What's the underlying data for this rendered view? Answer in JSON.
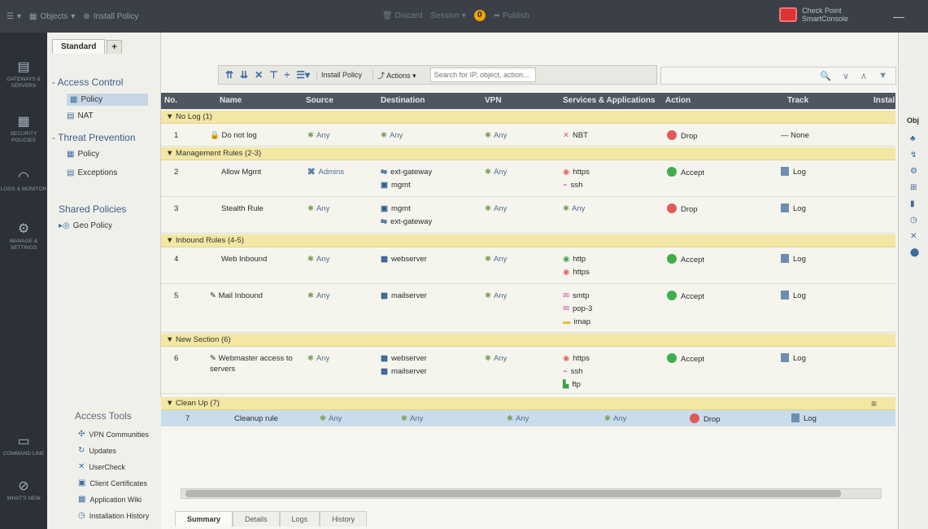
{
  "topbar": {
    "menu_label": "☰",
    "objects_label": "Objects",
    "install_policy_label": "Install Policy",
    "discard_label": "Discard",
    "session_label": "Session",
    "session_badge": "0",
    "publish_label": "Publish",
    "brand_line1": "Check Point",
    "brand_line2": "SmartConsole",
    "minimize": "—"
  },
  "left_rail": [
    {
      "icon": "gateways-icon",
      "glyph": "▤",
      "label": "GATEWAYS & SERVERS"
    },
    {
      "icon": "security-policies-icon",
      "glyph": "▦",
      "label": "SECURITY POLICIES"
    },
    {
      "icon": "logs-monitor-icon",
      "glyph": "◠",
      "label": "LOGS & MONITOR"
    },
    {
      "icon": "manage-settings-icon",
      "glyph": "⚙",
      "label": "MANAGE & SETTINGS"
    },
    {
      "icon": "command-line-icon",
      "glyph": "▭",
      "label": "COMMAND LINE"
    },
    {
      "icon": "whats-new-icon",
      "glyph": "⊘",
      "label": "WHAT'S NEW"
    }
  ],
  "tabs": {
    "standard": "Standard",
    "plus": "+"
  },
  "nav": {
    "access_control": "- Access Control",
    "policy": "Policy",
    "nat": "NAT",
    "threat_prevention": "- Threat Prevention",
    "tp_policy": "Policy",
    "exceptions": "Exceptions",
    "shared_policies": "Shared Policies",
    "geo_policy": "Geo Policy"
  },
  "access_tools": {
    "title": "Access Tools",
    "items": [
      "VPN Communities",
      "Updates",
      "UserCheck",
      "Client Certificates",
      "Application Wiki",
      "Installation History"
    ]
  },
  "toolbar": {
    "install_policy": "Install Policy",
    "actions": "Actions",
    "search_placeholder": "Search for IP, object, action..."
  },
  "table": {
    "headers": [
      "No.",
      "Name",
      "Source",
      "Destination",
      "VPN",
      "Services & Applications",
      "Action",
      "Track",
      "Instal"
    ],
    "sections": {
      "no_log": "▼ No Log (1)",
      "mgmt": "▼ Management Rules (2-3)",
      "inbound": "▼ Inbound Rules (4-5)",
      "new_section": "▼ New Section (6)",
      "cleanup": "▼ Clean Up (7)"
    },
    "rules": [
      {
        "no": "1",
        "name": "Do not log",
        "source": "Any",
        "dest": [
          "Any"
        ],
        "vpn": "Any",
        "services": [
          "NBT"
        ],
        "action": "Drop",
        "track": "— None"
      },
      {
        "no": "2",
        "name": "Allow Mgmt",
        "source": "Admins",
        "dest": [
          "ext-gateway",
          "mgmt"
        ],
        "vpn": "Any",
        "services": [
          "https",
          "ssh"
        ],
        "action": "Accept",
        "track": "Log"
      },
      {
        "no": "3",
        "name": "Stealth Rule",
        "source": "Any",
        "dest": [
          "mgmt",
          "ext-gateway"
        ],
        "vpn": "Any",
        "services": [
          "Any"
        ],
        "action": "Drop",
        "track": "Log"
      },
      {
        "no": "4",
        "name": "Web Inbound",
        "source": "Any",
        "dest": [
          "webserver"
        ],
        "vpn": "Any",
        "services": [
          "http",
          "https"
        ],
        "action": "Accept",
        "track": "Log"
      },
      {
        "no": "5",
        "name": "Mail Inbound",
        "source": "Any",
        "dest": [
          "mailserver"
        ],
        "vpn": "Any",
        "services": [
          "smtp",
          "pop-3",
          "imap"
        ],
        "action": "Accept",
        "track": "Log"
      },
      {
        "no": "6",
        "name": "Webmaster access to servers",
        "source": "Any",
        "dest": [
          "webserver",
          "mailserver"
        ],
        "vpn": "Any",
        "services": [
          "https",
          "ssh",
          "ftp"
        ],
        "action": "Accept",
        "track": "Log"
      },
      {
        "no": "7",
        "name": "Cleanup rule",
        "source": "Any",
        "dest": [
          "Any"
        ],
        "vpn": "Any",
        "services": [
          "Any"
        ],
        "action": "Drop",
        "track": "Log"
      }
    ]
  },
  "bottom_tabs": [
    "Summary",
    "Details",
    "Logs",
    "History"
  ],
  "right_panel": {
    "title": "Obj"
  }
}
